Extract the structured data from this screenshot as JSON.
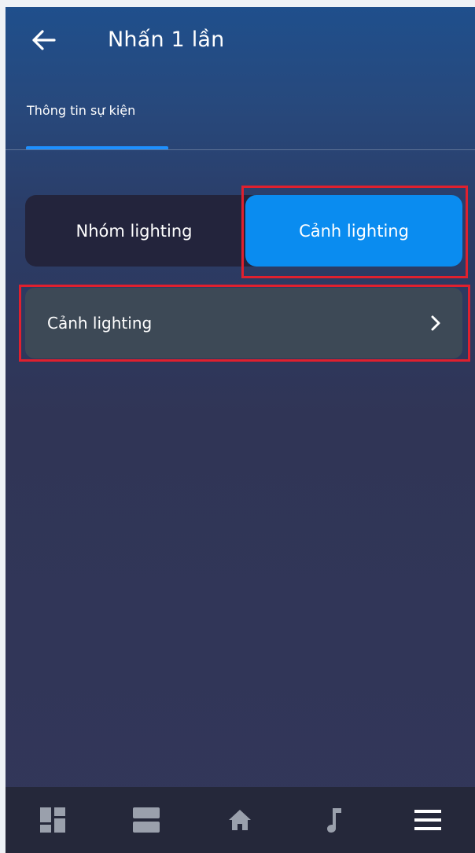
{
  "header": {
    "title": "Nhấn 1 lần",
    "back_icon": "arrow-left-icon"
  },
  "tabs": [
    {
      "label": "Thông tin sự kiện",
      "active": true
    }
  ],
  "segment": {
    "options": [
      "Nhóm lighting",
      "Cảnh lighting"
    ],
    "selected_index": 1
  },
  "list": {
    "items": [
      {
        "label": "Cảnh lighting",
        "icon": "chevron-right-icon"
      }
    ]
  },
  "bottom_nav": {
    "items": [
      {
        "icon": "dashboard-icon"
      },
      {
        "icon": "rooms-icon"
      },
      {
        "icon": "home-icon"
      },
      {
        "icon": "music-icon"
      },
      {
        "icon": "menu-icon"
      }
    ]
  },
  "colors": {
    "accent": "#0a8cf0",
    "highlight": "#e0202e",
    "nav_icon": "#9aa0ac"
  }
}
